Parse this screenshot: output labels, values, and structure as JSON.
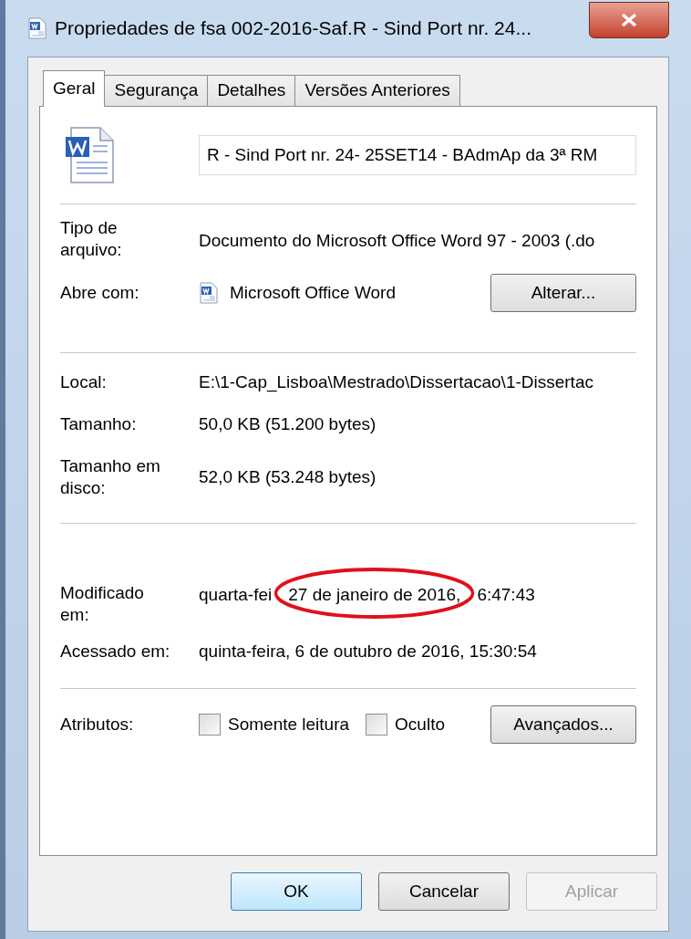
{
  "window": {
    "title": "Propriedades de fsa 002-2016-Saf.R - Sind Port nr. 24..."
  },
  "tabs": [
    {
      "label": "Geral",
      "selected": true
    },
    {
      "label": "Segurança",
      "selected": false
    },
    {
      "label": "Detalhes",
      "selected": false
    },
    {
      "label": "Versões Anteriores",
      "selected": false
    }
  ],
  "file_name": {
    "value": "R - Sind Port nr. 24- 25SET14 - BAdmAp da 3ª RM"
  },
  "file_type": {
    "label": "Tipo de arquivo:",
    "value": "Documento do Microsoft Office Word 97 - 2003 (.do"
  },
  "opens_with": {
    "label": "Abre com:",
    "app": "Microsoft Office Word",
    "button": "Alterar..."
  },
  "location": {
    "label": "Local:",
    "value": "E:\\1-Cap_Lisboa\\Mestrado\\Dissertacao\\1-Dissertac"
  },
  "size": {
    "label": "Tamanho:",
    "value": "50,0 KB (51.200 bytes)"
  },
  "size_on_disk": {
    "label": "Tamanho em disco:",
    "value": "52,0 KB (53.248 bytes)"
  },
  "modified": {
    "label": "Modificado em:",
    "value_parts": [
      "quarta-fei",
      "27 de janeiro de 2016,",
      "6:47:43"
    ]
  },
  "accessed": {
    "label": "Acessado em:",
    "value": "quinta-feira, 6 de outubro de 2016, 15:30:54"
  },
  "attributes": {
    "label": "Atributos:",
    "checkboxes": [
      {
        "label": "Somente leitura",
        "checked": false
      },
      {
        "label": "Oculto",
        "checked": false
      }
    ],
    "button": "Avançados..."
  },
  "buttons": [
    {
      "label": "OK",
      "default": true,
      "disabled": false
    },
    {
      "label": "Cancelar",
      "default": false,
      "disabled": false
    },
    {
      "label": "Aplicar",
      "default": false,
      "disabled": true
    }
  ]
}
